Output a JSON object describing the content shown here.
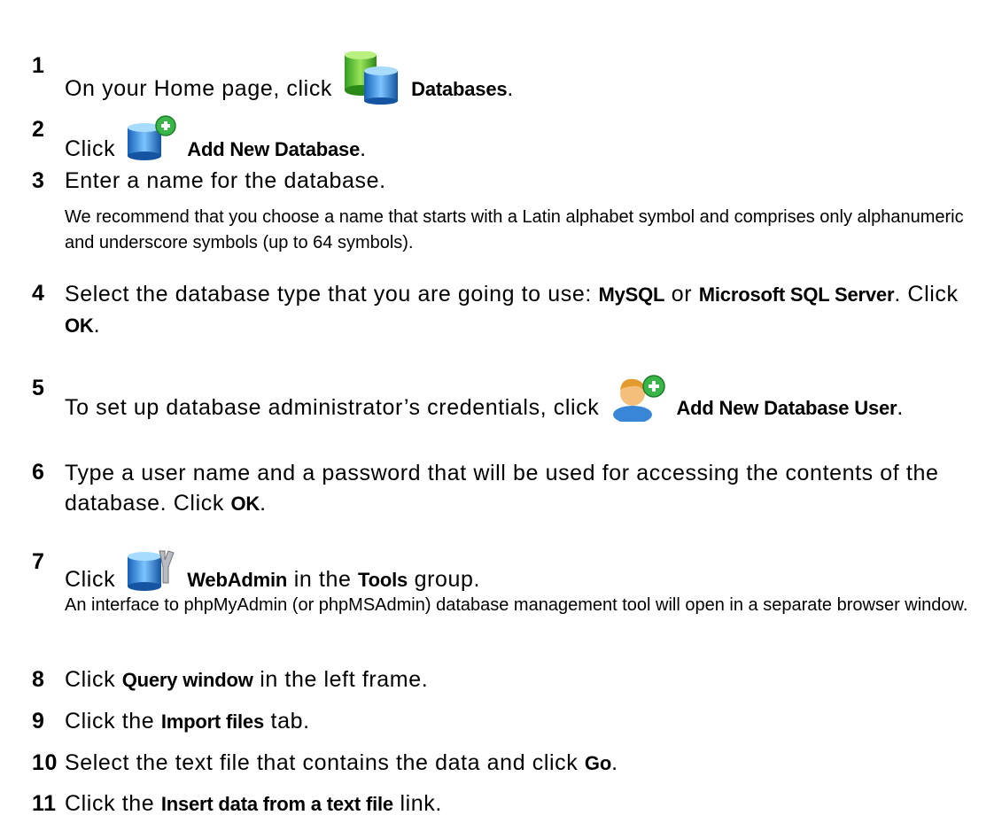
{
  "steps": [
    {
      "n": "1",
      "a": "On your Home page, click",
      "icon": "databases-icon",
      "b": "Databases",
      "c": "."
    },
    {
      "n": "2",
      "a": "Click",
      "icon": "add-database-icon",
      "b": "Add New Database",
      "c": "."
    },
    {
      "n": "3",
      "a": "Enter a name for the database."
    },
    {
      "n": "4",
      "a": "Select the database type that you are going to use:",
      "b": "MySQL",
      "c": "or",
      "d": "Microsoft SQL Server",
      "e": ". Click",
      "f": "OK",
      "g": "."
    },
    {
      "n": "5",
      "a": "To set up database administrator’s credentials, click",
      "icon": "add-database-user-icon",
      "b": "Add New Database User",
      "c": "."
    },
    {
      "n": "6",
      "a": "Type a user name and a password that will be used for accessing the contents of the database. Click",
      "b": "OK",
      "c": "."
    },
    {
      "n": "7",
      "a": "Click",
      "icon": "webadmin-icon",
      "b": "WebAdmin",
      "c": "in the",
      "d": "Tools",
      "e": "group."
    },
    {
      "n": "8",
      "a": "Click",
      "b": "Query window",
      "c": "in the left frame."
    },
    {
      "n": "9",
      "a": "Click the",
      "b": "Import files",
      "c": "tab."
    },
    {
      "n": "10",
      "a": "Select the text file that contains the data and click",
      "b": "Go",
      "c": "."
    },
    {
      "n": "11",
      "a": "Click the",
      "b": "Insert data from a text file",
      "c": "link."
    }
  ],
  "notes": {
    "step3": "We recommend that you choose a name that starts with a Latin alphabet symbol and comprises only alphanumeric and underscore symbols (up to 64 symbols).",
    "step7": "An interface to phpMyAdmin (or phpMSAdmin) database management tool will open in a separate browser window."
  }
}
